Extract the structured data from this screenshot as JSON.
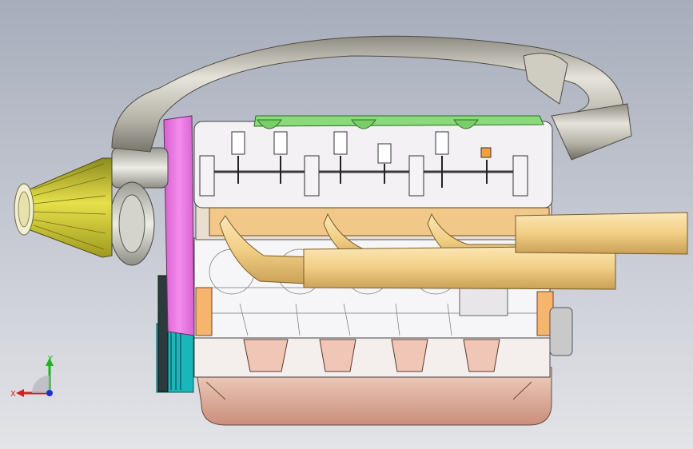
{
  "viewport": {
    "background_top": "#a7adbb",
    "background_bottom": "#e3e4e8"
  },
  "colors": {
    "air_filter": "#d8d22a",
    "intake_pipe": "#b9b7aa",
    "timing_cover": "#ef7be8",
    "valve_cover": "#f1eff3",
    "green_intake": "#86d977",
    "exhaust_header": "#f0d08a",
    "engine_block": "#f4f2f4",
    "oil_pan": "#e8b8a8",
    "pulley": "#16b8b8",
    "rocker_orange": "#f2a040"
  },
  "triad": {
    "x_label": "X",
    "y_label": "Y",
    "x_color": "#d42020",
    "y_color": "#20b020",
    "z_color": "#2030d0"
  }
}
